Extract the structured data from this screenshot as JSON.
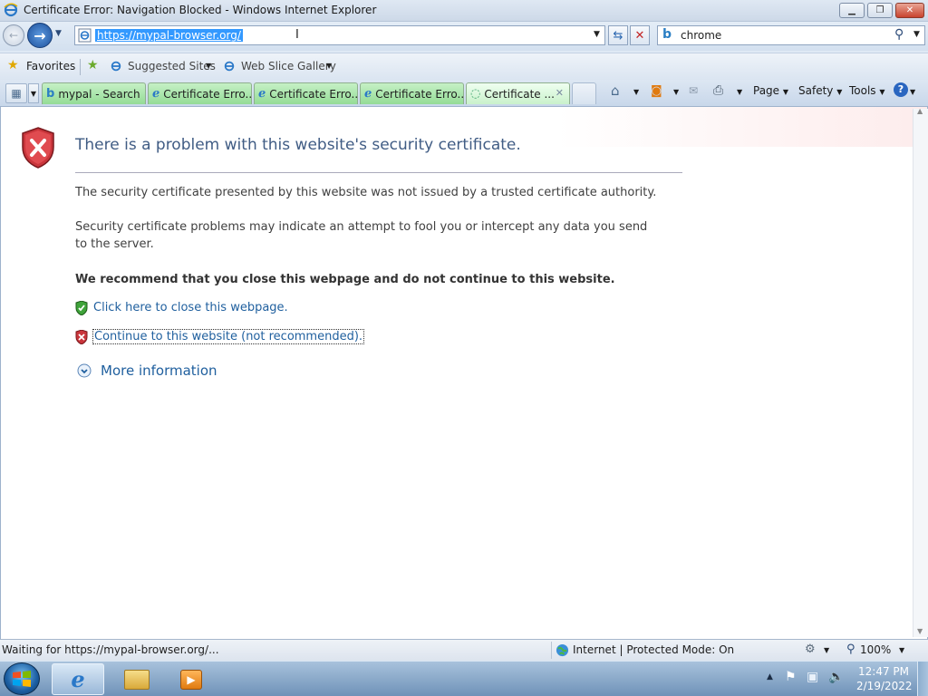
{
  "window": {
    "title": "Certificate Error: Navigation Blocked - Windows Internet Explorer"
  },
  "nav": {
    "url": "https://mypal-browser.org/",
    "search_value": "chrome"
  },
  "favorites": {
    "favorites_label": "Favorites",
    "suggested_sites": "Suggested Sites",
    "web_slice_gallery": "Web Slice Gallery"
  },
  "tabs": [
    {
      "label": "mypal - Search"
    },
    {
      "label": "Certificate Erro..."
    },
    {
      "label": "Certificate Erro..."
    },
    {
      "label": "Certificate Erro..."
    },
    {
      "label": "Certificate ..."
    }
  ],
  "commands": {
    "page": "Page",
    "safety": "Safety",
    "tools": "Tools"
  },
  "page": {
    "heading": "There is a problem with this website's security certificate.",
    "para1": "The security certificate presented by this website was not issued by a trusted certificate authority.",
    "para2": "Security certificate problems may indicate an attempt to fool you or intercept any data you send to the server.",
    "recommend": "We recommend that you close this webpage and do not continue to this website.",
    "close_link": "Click here to close this webpage.",
    "continue_link": "Continue to this website (not recommended).",
    "more_info": "More information"
  },
  "status": {
    "text": "Waiting for https://mypal-browser.org/...",
    "zone": "Internet | Protected Mode: On",
    "zoom": "100%"
  },
  "clock": {
    "time": "12:47 PM",
    "date": "2/19/2022"
  }
}
